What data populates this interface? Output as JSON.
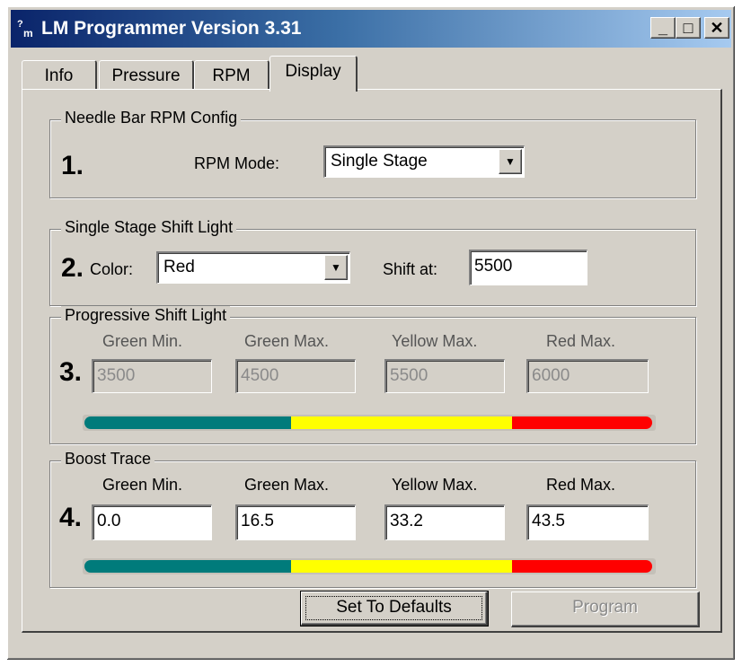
{
  "window": {
    "title": "LM Programmer Version 3.31",
    "icon_text": "?m",
    "controls": {
      "minimize": "_",
      "maximize": "□",
      "close": "✕"
    }
  },
  "tabs": [
    {
      "label": "Info",
      "active": false
    },
    {
      "label": "Pressure",
      "active": false
    },
    {
      "label": "RPM",
      "active": false
    },
    {
      "label": "Display",
      "active": true
    }
  ],
  "needle_bar": {
    "legend": "Needle Bar RPM Config",
    "step": "1.",
    "rpm_mode_label": "RPM Mode:",
    "rpm_mode_value": "Single Stage"
  },
  "single_stage": {
    "legend": "Single Stage Shift Light",
    "step": "2.",
    "color_label": "Color:",
    "color_value": "Red",
    "shift_label": "Shift at:",
    "shift_value": "5500"
  },
  "progressive": {
    "legend": "Progressive Shift Light",
    "step": "3.",
    "headers": [
      "Green Min.",
      "Green Max.",
      "Yellow Max.",
      "Red Max."
    ],
    "values": [
      "3500",
      "4500",
      "5500",
      "6000"
    ]
  },
  "boost": {
    "legend": "Boost Trace",
    "step": "4.",
    "headers": [
      "Green Min.",
      "Green Max.",
      "Yellow Max.",
      "Red Max."
    ],
    "values": [
      "0.0",
      "16.5",
      "33.2",
      "43.5"
    ]
  },
  "colors": {
    "green": "#007b7b",
    "yellow": "#ffff00",
    "red": "#ff0000"
  },
  "buttons": {
    "defaults": "Set To Defaults",
    "program": "Program"
  }
}
